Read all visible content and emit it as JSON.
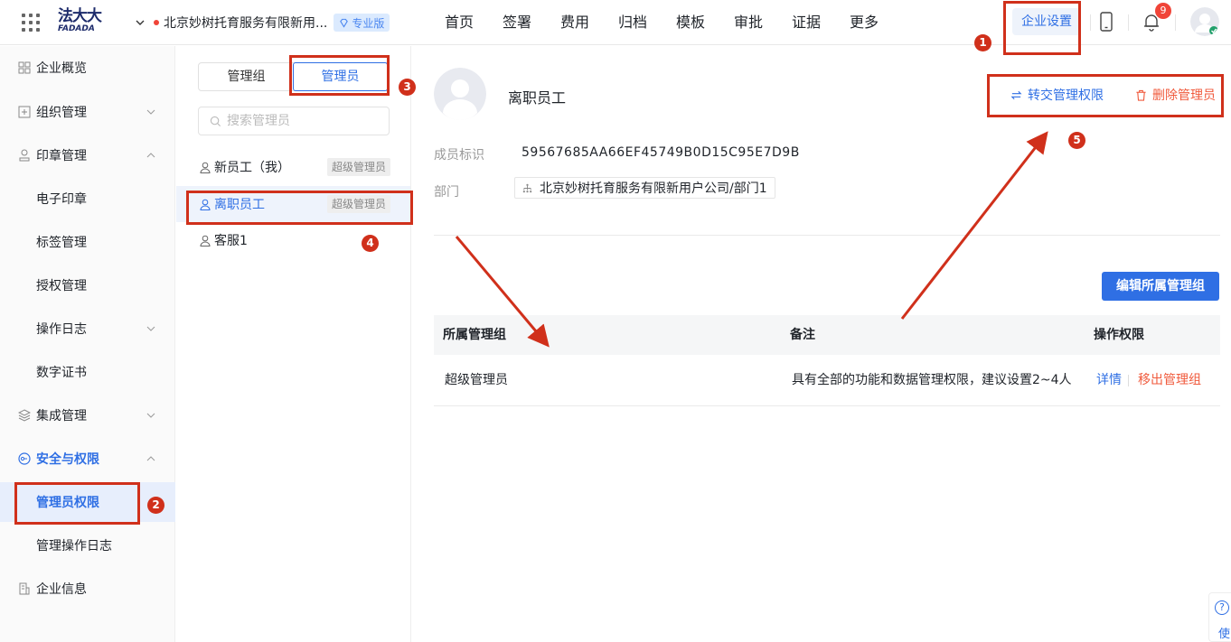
{
  "topbar": {
    "logo_text_top": "法大大",
    "logo_text_bottom": "FADADA",
    "company_name": "北京妙树托育服务有限新用...",
    "edition": "专业版",
    "nav": [
      "首页",
      "签署",
      "费用",
      "归档",
      "模板",
      "审批",
      "证据",
      "更多"
    ],
    "settings": "企业设置",
    "notification_count": "9"
  },
  "sidebar": {
    "items": [
      {
        "label": "企业概览",
        "icon": "overview-icon"
      },
      {
        "label": "组织管理",
        "icon": "org-icon"
      },
      {
        "label": "印章管理",
        "icon": "seal-icon"
      },
      {
        "label": "电子印章"
      },
      {
        "label": "标签管理"
      },
      {
        "label": "授权管理"
      },
      {
        "label": "操作日志"
      },
      {
        "label": "数字证书"
      },
      {
        "label": "集成管理",
        "icon": "layers-icon"
      },
      {
        "label": "安全与权限",
        "icon": "security-icon"
      },
      {
        "label": "管理员权限"
      },
      {
        "label": "管理操作日志"
      },
      {
        "label": "企业信息",
        "icon": "building-icon"
      }
    ]
  },
  "list_panel": {
    "tabs": [
      "管理组",
      "管理员"
    ],
    "search_placeholder": "搜索管理员",
    "members": [
      {
        "name": "新员工（我）",
        "tag": "超级管理员"
      },
      {
        "name": "离职员工",
        "tag": "超级管理员"
      },
      {
        "name": "客服1",
        "tag": ""
      }
    ]
  },
  "detail": {
    "name": "离职员工",
    "transfer": "转交管理权限",
    "delete": "删除管理员",
    "member_id_label": "成员标识",
    "member_id": "59567685AA66EF45749B0D15C95E7D9B",
    "dept_label": "部门",
    "dept": "北京妙树托育服务有限新用户公司/部门1",
    "edit_button": "编辑所属管理组",
    "table": {
      "headers": [
        "所属管理组",
        "备注",
        "操作权限"
      ],
      "rows": [
        {
          "group": "超级管理员",
          "note": "具有全部的功能和数据管理权限，建议设置2~4人",
          "detail": "详情",
          "remove": "移出管理组"
        }
      ]
    }
  },
  "annotations": [
    "1",
    "2",
    "3",
    "4",
    "5"
  ],
  "help": {
    "text": "使"
  },
  "colors": {
    "accent": "#2f6fe4",
    "danger": "#f05a3c",
    "annotation": "#d0301b"
  }
}
